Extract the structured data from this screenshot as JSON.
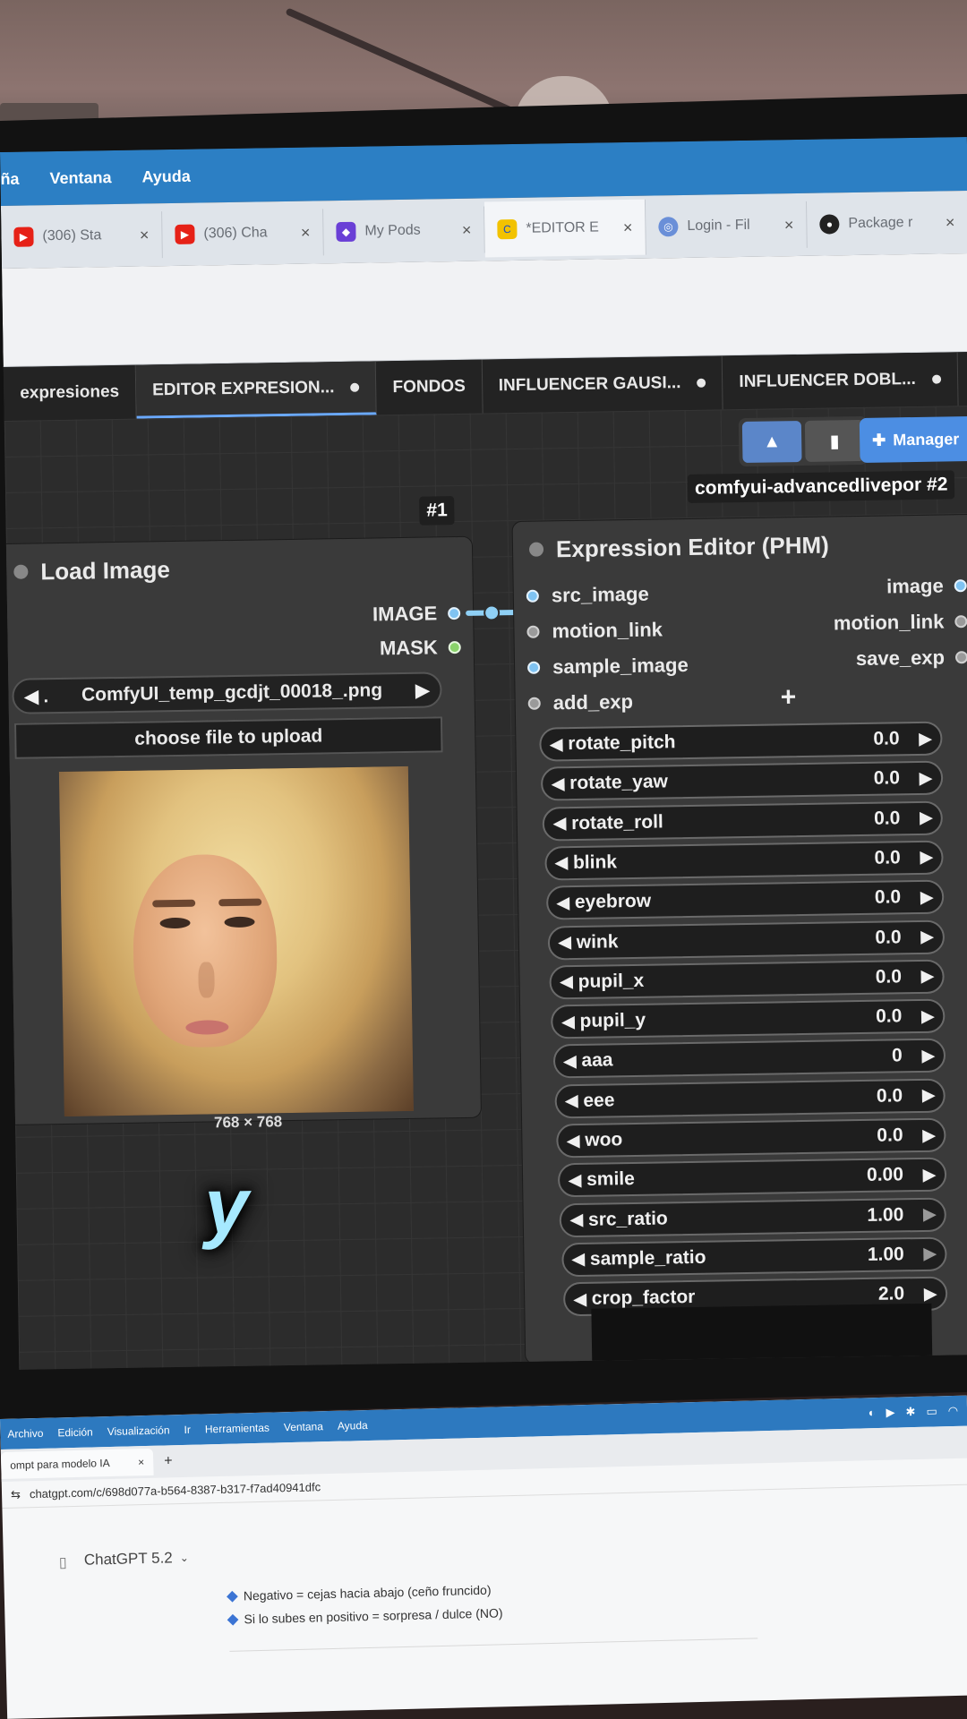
{
  "browser": {
    "menu": [
      "ña",
      "Ventana",
      "Ayuda"
    ],
    "tabs": [
      {
        "title": "(306) Sta",
        "icon": "youtube-icon"
      },
      {
        "title": "(306) Cha",
        "icon": "youtube-icon"
      },
      {
        "title": "My Pods",
        "icon": "runpod-icon"
      },
      {
        "title": "*EDITOR E",
        "icon": "comfy-icon",
        "active": true
      },
      {
        "title": "Login - Fil",
        "icon": "globe-icon"
      },
      {
        "title": "Package r",
        "icon": "github-icon"
      }
    ],
    "close_glyph": "×"
  },
  "workflow_tabs": [
    {
      "label": "expresiones",
      "dot": false
    },
    {
      "label": "EDITOR EXPRESION...",
      "dot": true,
      "active": true
    },
    {
      "label": "FONDOS",
      "dot": false
    },
    {
      "label": "INFLUENCER GAUSI...",
      "dot": true
    },
    {
      "label": "INFLUENCER DOBL...",
      "dot": true
    }
  ],
  "new_tab_glyph": "+",
  "toolbar": {
    "manager_label": "Manager"
  },
  "badges": {
    "node1": "#1",
    "node2": "comfyui-advancedlivepor  #2"
  },
  "load_image": {
    "title": "Load Image",
    "outputs": [
      "IMAGE",
      "MASK"
    ],
    "file": "ComfyUI_temp_gcdjt_00018_.png",
    "upload_label": "choose file to upload",
    "dims": "768 × 768"
  },
  "caption": "y",
  "expression_editor": {
    "title": "Expression Editor (PHM)",
    "inputs": [
      "src_image",
      "motion_link",
      "sample_image",
      "add_exp"
    ],
    "outputs": [
      "image",
      "motion_link",
      "save_exp"
    ],
    "add_glyph": "+",
    "widgets": [
      {
        "name": "rotate_pitch",
        "value": "0.0"
      },
      {
        "name": "rotate_yaw",
        "value": "0.0"
      },
      {
        "name": "rotate_roll",
        "value": "0.0"
      },
      {
        "name": "blink",
        "value": "0.0"
      },
      {
        "name": "eyebrow",
        "value": "0.0"
      },
      {
        "name": "wink",
        "value": "0.0"
      },
      {
        "name": "pupil_x",
        "value": "0.0"
      },
      {
        "name": "pupil_y",
        "value": "0.0"
      },
      {
        "name": "aaa",
        "value": "0"
      },
      {
        "name": "eee",
        "value": "0.0"
      },
      {
        "name": "woo",
        "value": "0.0"
      },
      {
        "name": "smile",
        "value": "0.00"
      },
      {
        "name": "src_ratio",
        "value": "1.00"
      },
      {
        "name": "sample_ratio",
        "value": "1.00"
      },
      {
        "name": "crop_factor",
        "value": "2.0"
      }
    ]
  },
  "laptop": {
    "menu": [
      "Archivo",
      "Edición",
      "Visualización",
      "Ir",
      "Herramientas",
      "Ventana",
      "Ayuda"
    ],
    "tab_title": "ompt para modelo IA",
    "url": "chatgpt.com/c/698d077a-b564-8387-b317-f7ad40941dfc",
    "model": "ChatGPT 5.2",
    "bullets": [
      "Negativo = cejas hacia abajo (ceño fruncido)",
      "Si lo subes en positivo = sorpresa / dulce (NO)"
    ]
  }
}
